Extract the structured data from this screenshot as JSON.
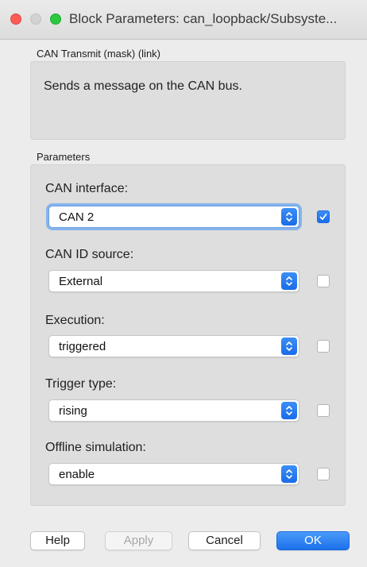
{
  "window": {
    "title": "Block Parameters: can_loopback/Subsyste...",
    "controls": [
      "close-icon",
      "minimize-icon",
      "maximize-icon"
    ]
  },
  "description": {
    "label": "CAN Transmit (mask) (link)",
    "text": "Sends a message on the CAN bus."
  },
  "parameters": {
    "label": "Parameters",
    "fields": [
      {
        "label": "CAN interface:",
        "value": "CAN 2",
        "checked": true,
        "focused": true
      },
      {
        "label": "CAN ID source:",
        "value": "External",
        "checked": false
      },
      {
        "label": "Execution:",
        "value": "triggered",
        "checked": false
      },
      {
        "label": "Trigger type:",
        "value": "rising",
        "checked": false
      },
      {
        "label": "Offline simulation:",
        "value": "enable",
        "checked": false
      }
    ]
  },
  "buttons": {
    "help": "Help",
    "apply": "Apply",
    "cancel": "Cancel",
    "ok": "OK"
  },
  "colors": {
    "accent": "#1a6ce8",
    "close": "#fd5c56",
    "maximize": "#2bc840"
  }
}
